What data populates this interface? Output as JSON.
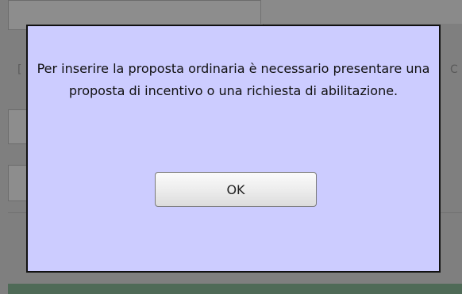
{
  "background": {
    "partial_glyphs": [
      "[",
      "C"
    ]
  },
  "dialog": {
    "message": "Per inserire la proposta ordinaria è necessario presentare una proposta di incentivo o una richiesta di abilitazione.",
    "ok_label": "OK"
  },
  "colors": {
    "dialog_bg": "#ccccff",
    "dialog_border": "#111111",
    "overlay": "#7f7f7f",
    "footer_bar": "#4f6a57"
  }
}
